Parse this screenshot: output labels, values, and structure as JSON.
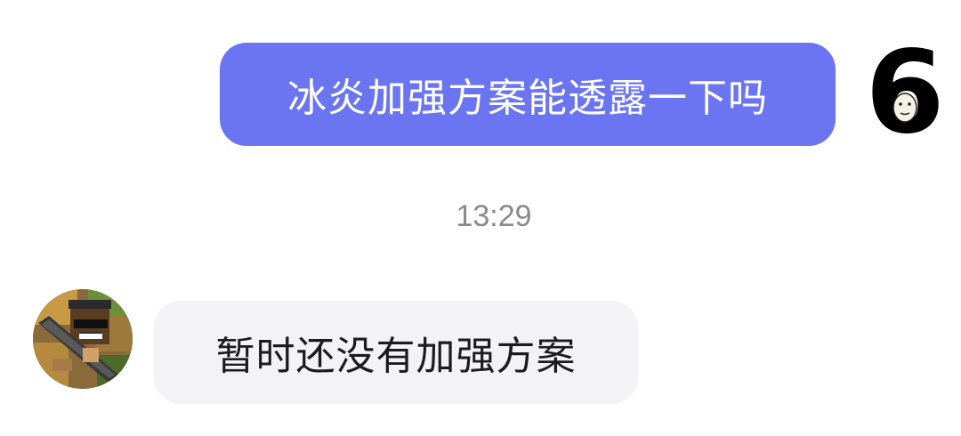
{
  "messages": {
    "outgoing": {
      "text": "冰炎加强方案能透露一下吗",
      "avatar": {
        "icon": "number-six-face-icon",
        "glyph": "6"
      }
    },
    "timestamp": "13:29",
    "incoming": {
      "text": "暂时还没有加强方案",
      "avatar": {
        "icon": "pixel-soldier-avatar-icon"
      }
    }
  },
  "colors": {
    "outgoing_bubble": "#6b75f2",
    "incoming_bubble": "#f3f3f5",
    "timestamp_text": "#8a8a8a",
    "background": "#ffffff"
  }
}
